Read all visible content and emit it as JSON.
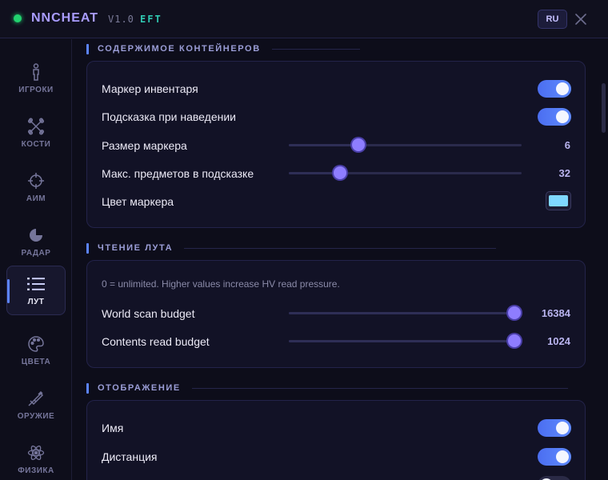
{
  "header": {
    "title": "NNCHEAT",
    "version": "V1.0",
    "game": "EFT",
    "lang": "RU",
    "close_icon": "close-icon"
  },
  "sidebar": {
    "items": [
      {
        "label": "ИГРОКИ",
        "icon": "person-icon",
        "active": false
      },
      {
        "label": "КОСТИ",
        "icon": "bones-icon",
        "active": false
      },
      {
        "label": "АИМ",
        "icon": "crosshair-icon",
        "active": false
      },
      {
        "label": "РАДАР",
        "icon": "radar-icon",
        "active": false
      },
      {
        "label": "ЛУТ",
        "icon": "list-icon",
        "active": true
      },
      {
        "label": "ЦВЕТА",
        "icon": "palette-icon",
        "active": false
      },
      {
        "label": "ОРУЖИЕ",
        "icon": "rifle-icon",
        "active": false
      },
      {
        "label": "ФИЗИКА",
        "icon": "atom-icon",
        "active": false
      }
    ]
  },
  "sections": {
    "containers": {
      "title": "СОДЕРЖИМОЕ КОНТЕЙНЕРОВ",
      "inventory_marker": {
        "label": "Маркер инвентаря",
        "on": true
      },
      "hover_hint": {
        "label": "Подсказка при наведении",
        "on": true
      },
      "marker_size": {
        "label": "Размер маркера",
        "value": "6",
        "fraction": 0.3
      },
      "max_items": {
        "label": "Макс. предметов в подсказке",
        "value": "32",
        "fraction": 0.22
      },
      "marker_color": {
        "label": "Цвет маркера",
        "color": "#7fd8ff"
      }
    },
    "loot_reading": {
      "title": "ЧТЕНИЕ ЛУТА",
      "hint": "0 = unlimited. Higher values increase HV read pressure.",
      "world_scan": {
        "label": "World scan budget",
        "value": "16384",
        "fraction": 0.97
      },
      "contents_read": {
        "label": "Contents read budget",
        "value": "1024",
        "fraction": 0.97
      }
    },
    "display": {
      "title": "ОТОБРАЖЕНИЕ",
      "name": {
        "label": "Имя",
        "on": true
      },
      "distance": {
        "label": "Дистанция",
        "on": true
      },
      "third": {
        "on": false
      }
    }
  },
  "colors": {
    "accent": "#5c84ff",
    "brand": "#a99cff",
    "status_online": "#22d36f",
    "game_tag": "#2fc7b0"
  }
}
